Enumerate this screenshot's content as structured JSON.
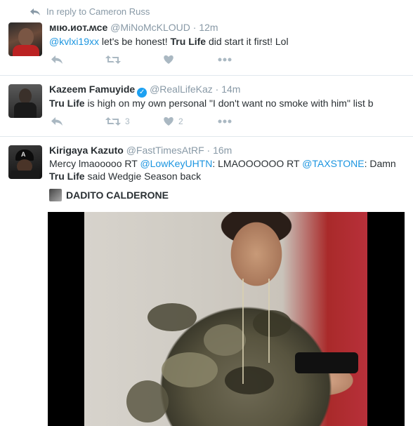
{
  "reply_context": {
    "text": "In reply to Cameron Russ"
  },
  "colors": {
    "accent": "#1b95e0",
    "muted": "#8899a6",
    "icon": "#aab8c2"
  },
  "tweets": [
    {
      "name": "мιю.иoт.ʍce",
      "handle": "@MiNoMcKLOUD",
      "time": "12m",
      "text_parts": [
        "@kvlxi19xx",
        " let's be honest! ",
        "Tru Life",
        " did start it first! Lol"
      ],
      "retweets": "",
      "likes": ""
    },
    {
      "name": "Kazeem Famuyide",
      "verified": true,
      "handle": "@RealLifeKaz",
      "time": "14m",
      "text_parts": [
        "Tru Life",
        " is high on my own personal \"I don't want no smoke with him\" list b"
      ],
      "retweets": "3",
      "likes": "2"
    },
    {
      "name": "Kirigaya Kazuto",
      "handle": "@FastTimesAtRF",
      "time": "16m",
      "text_parts": [
        "Mercy lmaooooo RT ",
        "@LowKeyUHTN",
        ": LMAOOOOOO RT ",
        "@TAXSTONE",
        ": Damn",
        "Tru Life",
        " said Wedgie Season back"
      ],
      "media_source": "DADITO CALDERONE"
    }
  ],
  "icons": {
    "reply": "reply-icon",
    "retweet": "retweet-icon",
    "like": "heart-icon",
    "more": "more-icon"
  }
}
